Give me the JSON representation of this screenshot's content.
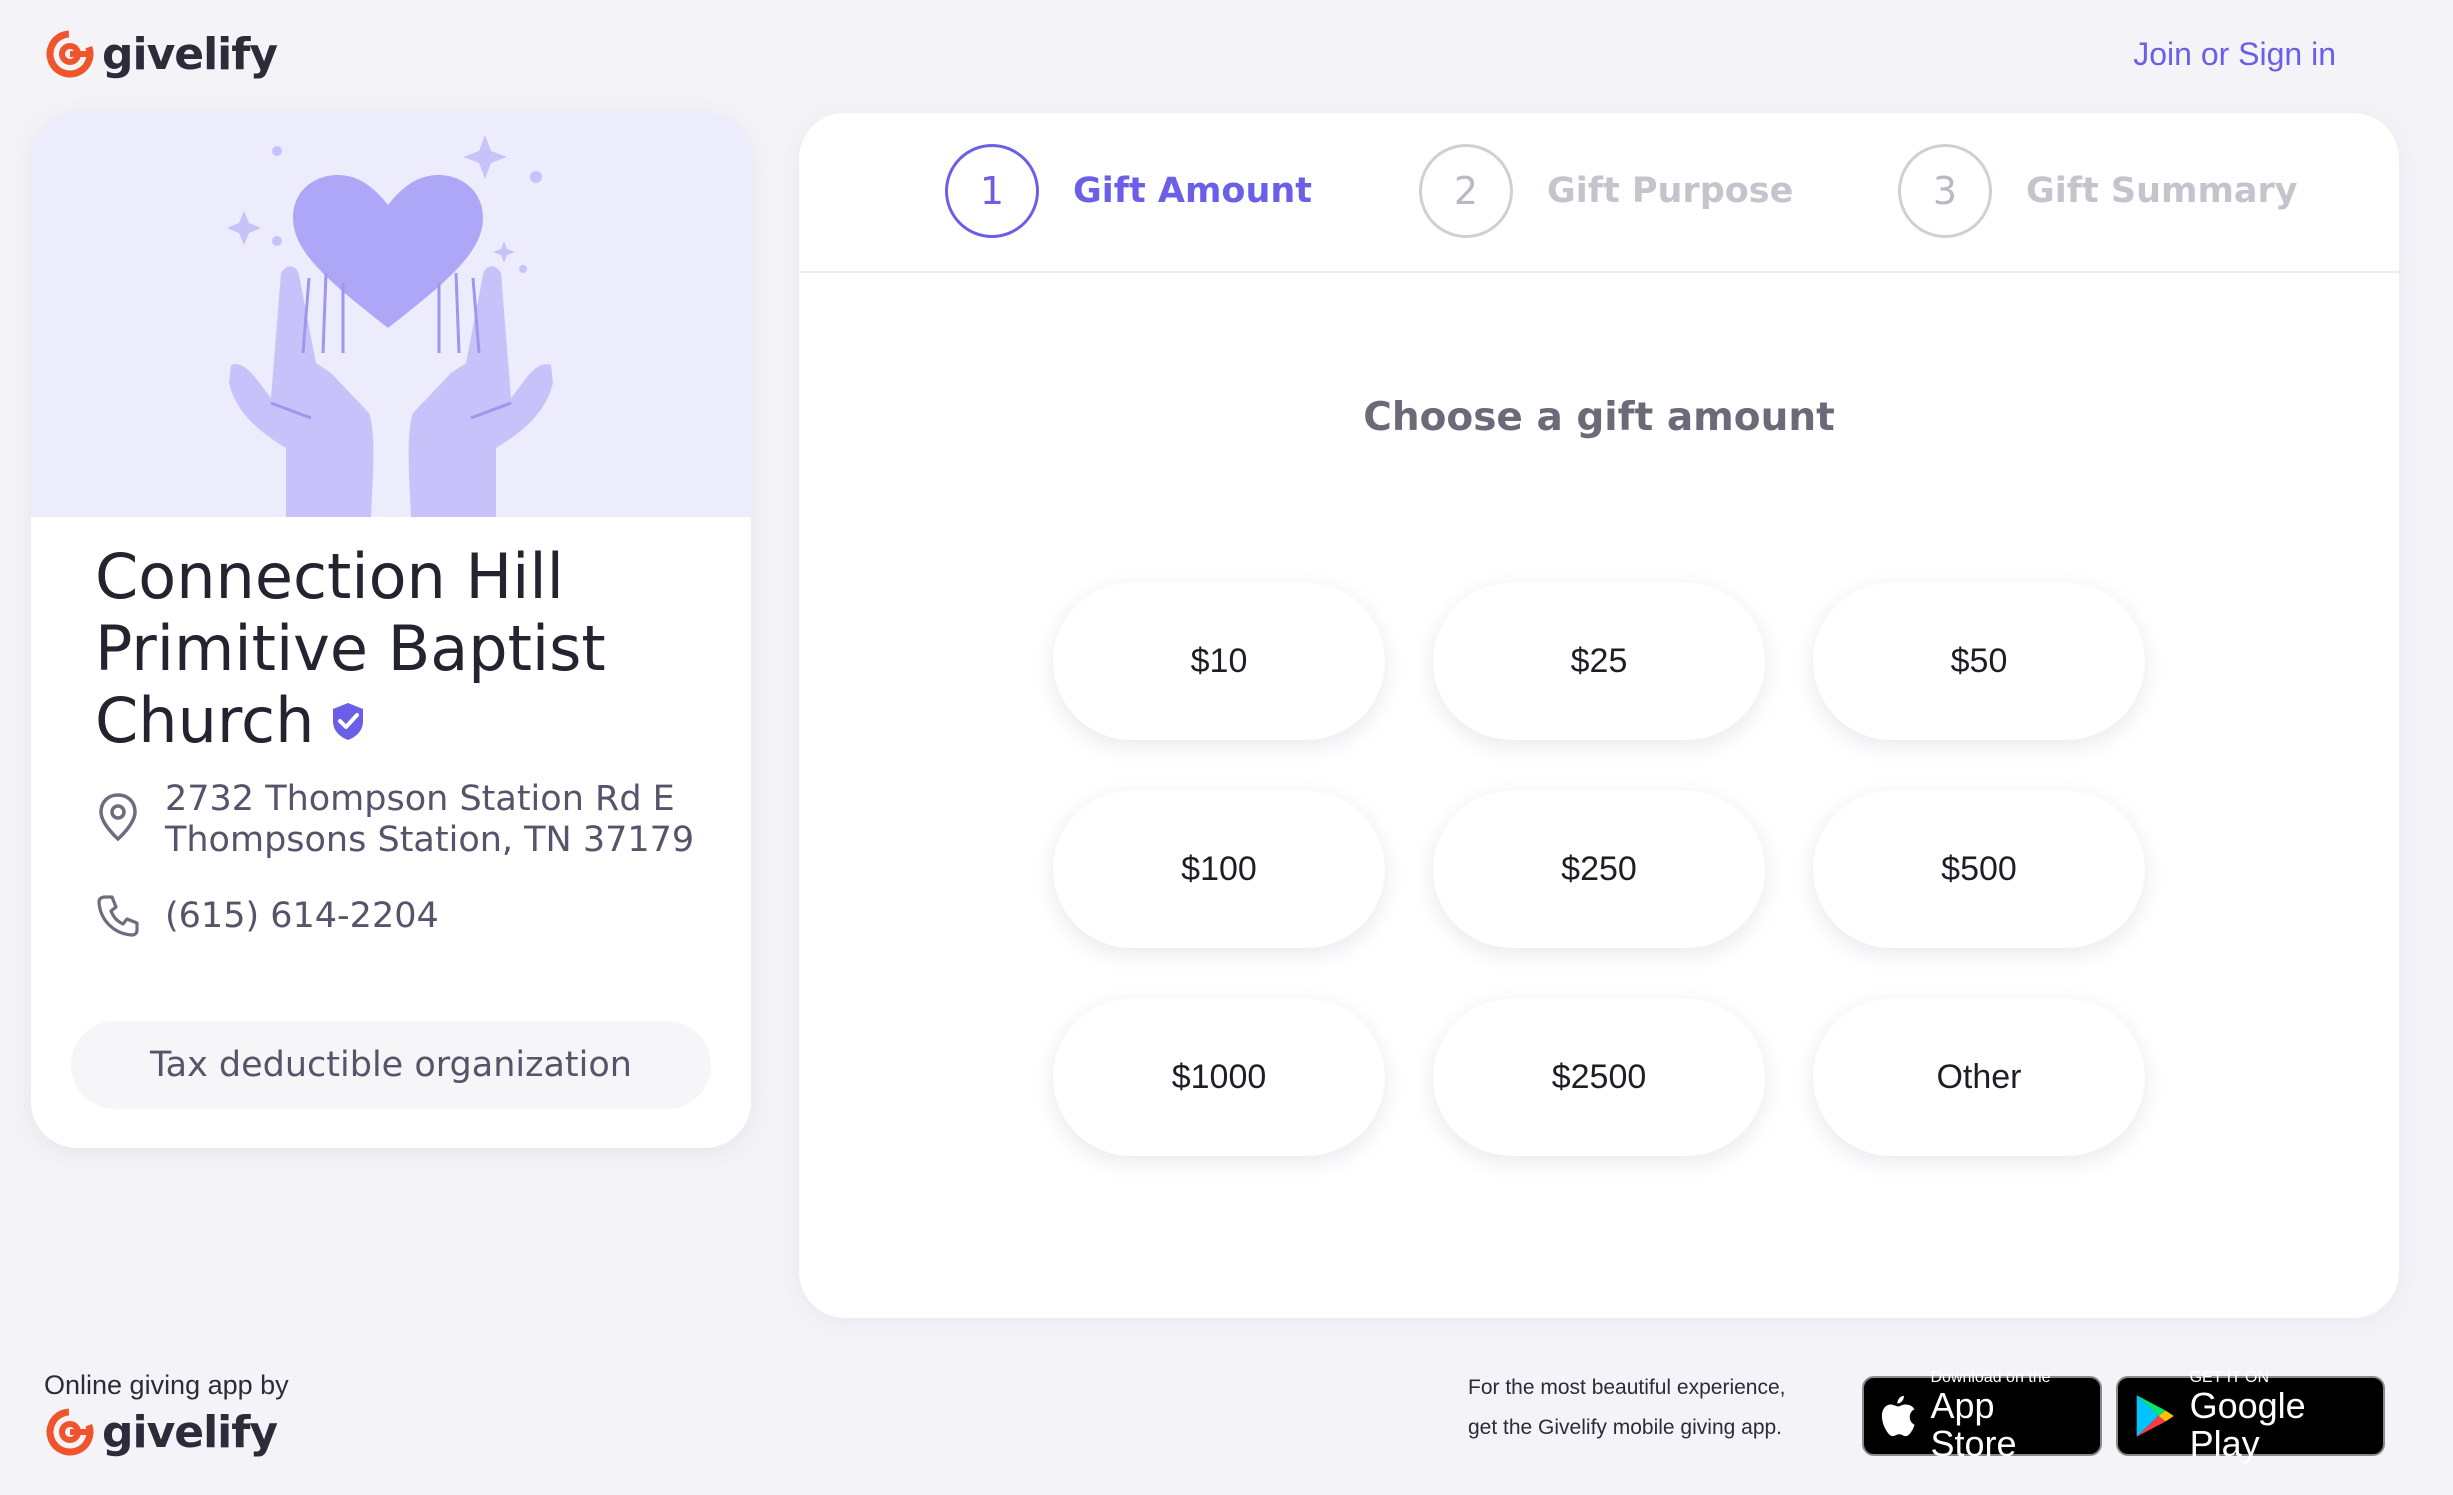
{
  "brand": {
    "name": "givelify"
  },
  "header": {
    "join_link": "Join or Sign in"
  },
  "organization": {
    "name": "Connection Hill Primitive Baptist Church",
    "address_line1": "2732 Thompson Station Rd E",
    "address_line2": "Thompsons Station, TN 37179",
    "phone": "(615) 614-2204",
    "tax_badge": "Tax deductible organization"
  },
  "steps": [
    {
      "number": "1",
      "label": "Gift Amount",
      "active": true
    },
    {
      "number": "2",
      "label": "Gift Purpose",
      "active": false
    },
    {
      "number": "3",
      "label": "Gift Summary",
      "active": false
    }
  ],
  "gift": {
    "title": "Choose a gift amount",
    "amounts": [
      "$10",
      "$25",
      "$50",
      "$100",
      "$250",
      "$500",
      "$1000",
      "$2500",
      "Other"
    ]
  },
  "footer": {
    "by_text": "Online giving app by",
    "promo_line1": "For the most beautiful experience,",
    "promo_line2": "get the Givelify mobile giving app.",
    "appstore_small": "Download on the",
    "appstore_big": "App Store",
    "googleplay_small": "GET IT ON",
    "googleplay_big": "Google Play"
  },
  "colors": {
    "accent": "#6a5fe6",
    "brand_orange": "#f0542d",
    "hero_bg": "#ececfc"
  }
}
